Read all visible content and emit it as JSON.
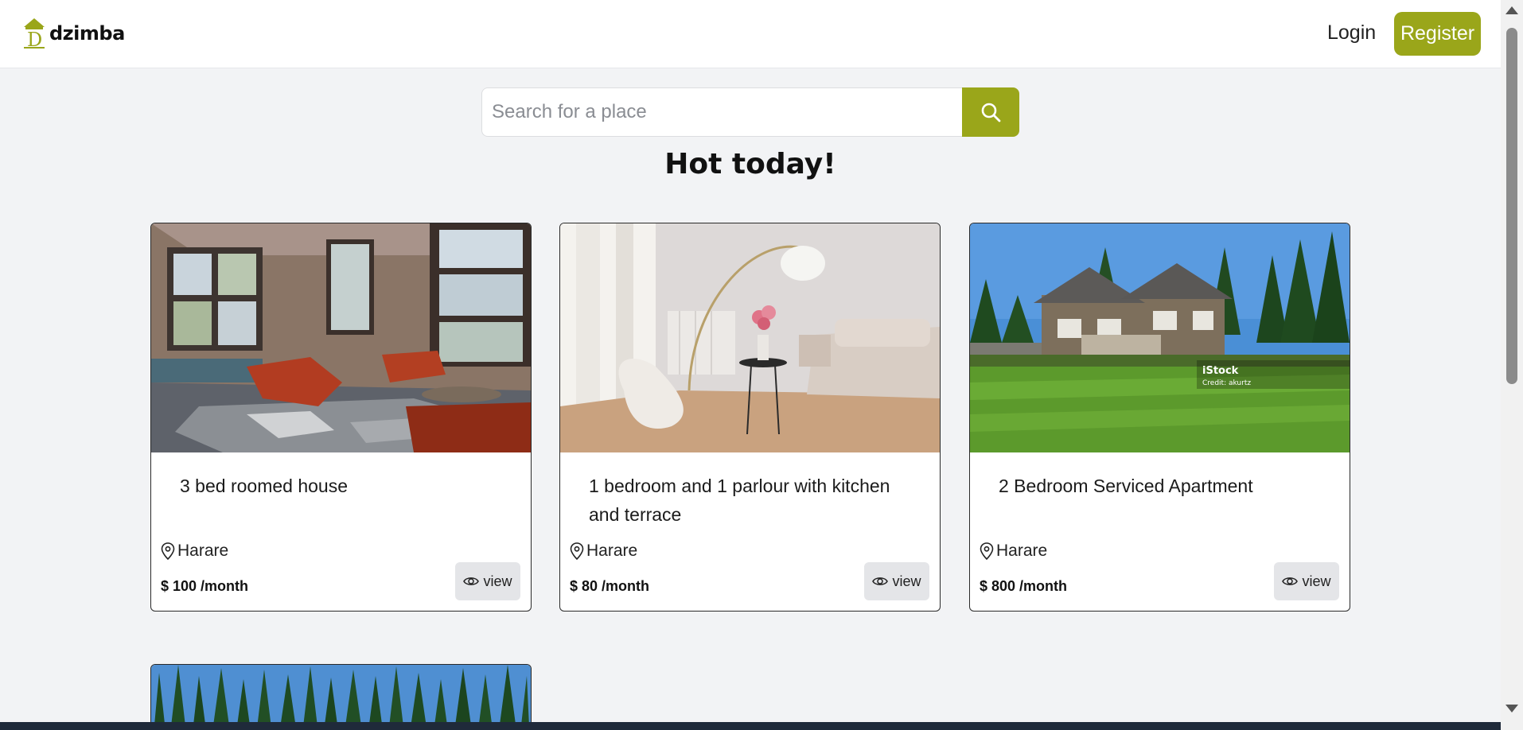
{
  "brand": {
    "name": "dzimba",
    "accent": "#9aa61a"
  },
  "nav": {
    "login_label": "Login",
    "register_label": "Register"
  },
  "search": {
    "placeholder": "Search for a place",
    "icon": "search-icon"
  },
  "section": {
    "title": "Hot today!"
  },
  "listings": [
    {
      "title": "3 bed roomed house",
      "location": "Harare",
      "price": "$ 100 /month",
      "view_label": "view",
      "image": "living-room-photo"
    },
    {
      "title": "1 bedroom and 1 parlour with kitchen and terrace",
      "location": "Harare",
      "price": "$ 80 /month",
      "view_label": "view",
      "image": "lounge-photo"
    },
    {
      "title": "2 Bedroom Serviced Apartment",
      "location": "Harare",
      "price": "$ 800 /month",
      "view_label": "view",
      "image": "house-lawn-photo",
      "watermark": "iStock",
      "watermark_credit": "Credit: akurtz"
    }
  ],
  "partial_listing": {
    "image": "forest-house-photo"
  }
}
